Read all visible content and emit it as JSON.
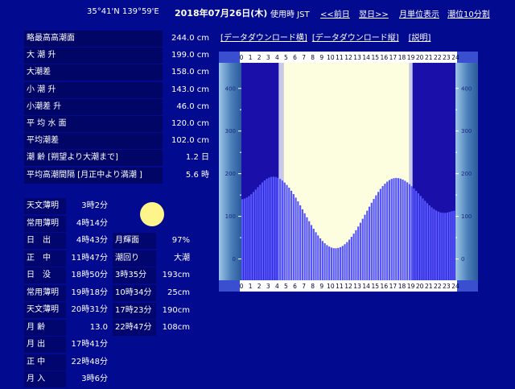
{
  "header": {
    "coords": "35°41'N 139°59'E",
    "date": "2018年07月26日(木)",
    "timezone": "使用時 JST",
    "prev_link": "<<前日",
    "next_link": "翌日>>",
    "monthly_link": "月単位表示",
    "interval_link": "潮位10分割"
  },
  "stats": [
    {
      "label": "略最高高潮面",
      "value": "244.0 cm"
    },
    {
      "label": "大 潮 升",
      "value": "199.0 cm"
    },
    {
      "label": "大潮差",
      "value": "158.0 cm"
    },
    {
      "label": "小 潮 升",
      "value": "143.0 cm"
    },
    {
      "label": "小潮差 升",
      "value": "46.0 cm"
    },
    {
      "label": "平 均 水 面",
      "value": "120.0 cm"
    },
    {
      "label": "平均潮差",
      "value": "102.0 cm"
    },
    {
      "label": "潮 齢 [朔望より大潮まで]",
      "value": "1.2 日"
    },
    {
      "label": "平均高潮間隔 [月正中より満潮 ]",
      "value": "5.6 時"
    }
  ],
  "sun": [
    {
      "label": "天文薄明",
      "value": "3時2分"
    },
    {
      "label": "常用薄明",
      "value": "4時14分"
    },
    {
      "label": "日　出",
      "value": "4時43分"
    },
    {
      "label": "正　中",
      "value": "11時47分"
    },
    {
      "label": "日　没",
      "value": "18時50分"
    },
    {
      "label": "常用薄明",
      "value": "19時18分"
    },
    {
      "label": "天文薄明",
      "value": "20時31分"
    },
    {
      "label": "月 齢",
      "value": "13.0"
    },
    {
      "label": "月 出",
      "value": "17時41分"
    },
    {
      "label": "正 中",
      "value": "22時48分"
    },
    {
      "label": "月 入",
      "value": "3時6分"
    }
  ],
  "moon": [
    {
      "label": "月輝面",
      "value": "97%"
    },
    {
      "label": "潮回り",
      "value": "大潮"
    },
    {
      "label": "3時35分",
      "value": "193cm"
    },
    {
      "label": "10時34分",
      "value": "25cm"
    },
    {
      "label": "17時23分",
      "value": "190cm"
    },
    {
      "label": "22時47分",
      "value": "108cm"
    }
  ],
  "links": {
    "download_h": "[データダウンロード横]",
    "download_v": "[データダウンロード縦]",
    "help": "[説明]"
  },
  "chart_data": {
    "type": "bar",
    "x_hours": [
      0,
      1,
      2,
      3,
      4,
      5,
      6,
      7,
      8,
      9,
      10,
      11,
      12,
      13,
      14,
      15,
      16,
      17,
      18,
      19,
      20,
      21,
      22,
      23,
      24
    ],
    "y_ticks": [
      0,
      100,
      200,
      300,
      400
    ],
    "ylim": [
      -50,
      460
    ],
    "daylight": [
      4.72,
      18.83
    ],
    "tide_extremes": [
      {
        "hour": 0.0,
        "cm": 140
      },
      {
        "hour": 3.58,
        "cm": 193
      },
      {
        "hour": 10.57,
        "cm": 25
      },
      {
        "hour": 17.38,
        "cm": 190
      },
      {
        "hour": 22.78,
        "cm": 108
      },
      {
        "hour": 24.0,
        "cm": 113
      }
    ],
    "colors": {
      "tide": "#5555ff",
      "daylight": "#fdfde0",
      "night": "#1a0fa8",
      "axis": "#6a8fc8"
    }
  }
}
